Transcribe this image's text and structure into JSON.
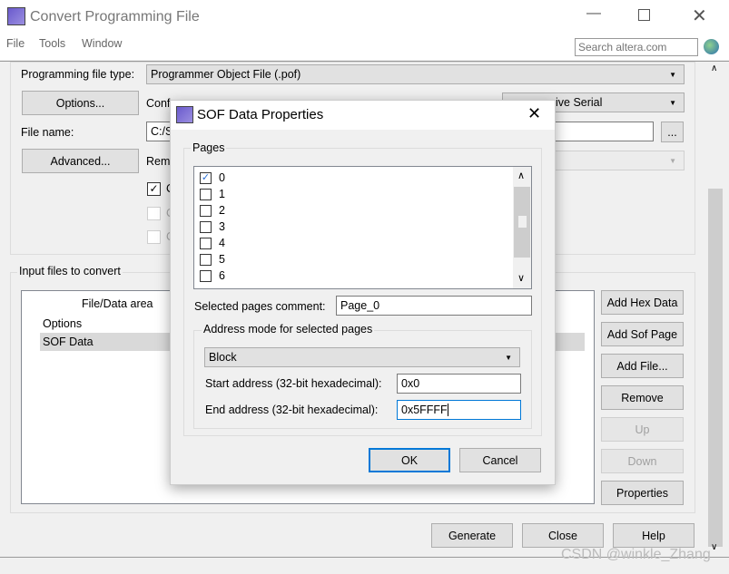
{
  "window": {
    "title": "Convert Programming File",
    "menu": [
      "File",
      "Tools",
      "Window"
    ],
    "search_placeholder": "Search altera.com"
  },
  "form": {
    "programming_file_type_label": "Programming file type:",
    "programming_file_type_value": "Programmer Object File (.pof)",
    "options_button": "Options...",
    "conf_fragment": "Conf",
    "mode_value_fragment": "ive Serial",
    "file_name_label": "File name:",
    "file_name_fragment": "C:/S",
    "browse_button": "...",
    "advanced_button": "Advanced...",
    "rem_fragment": "Rem",
    "cb_fragment": "C",
    "checkbox_checked": true
  },
  "input_files": {
    "group_label": "Input files to convert",
    "column_header": "File/Data area",
    "items": [
      "Options",
      "SOF Data"
    ],
    "selected": "SOF Data",
    "buttons": [
      "Add Hex Data",
      "Add Sof Page",
      "Add File...",
      "Remove",
      "Up",
      "Down",
      "Properties"
    ],
    "disabled": [
      "Up",
      "Down"
    ]
  },
  "footer": {
    "generate": "Generate",
    "close": "Close",
    "help": "Help",
    "watermark": "CSDN @winkle_Zhang"
  },
  "dialog": {
    "title": "SOF Data Properties",
    "pages_label": "Pages",
    "pages": [
      {
        "label": "0",
        "checked": true
      },
      {
        "label": "1",
        "checked": false
      },
      {
        "label": "2",
        "checked": false
      },
      {
        "label": "3",
        "checked": false
      },
      {
        "label": "4",
        "checked": false
      },
      {
        "label": "5",
        "checked": false
      },
      {
        "label": "6",
        "checked": false
      }
    ],
    "comment_label": "Selected pages comment:",
    "comment_value": "Page_0",
    "address_group_label": "Address mode for selected pages",
    "address_mode": "Block",
    "start_label": "Start address (32-bit hexadecimal):",
    "start_value": "0x0",
    "end_label": "End address (32-bit hexadecimal):",
    "end_value": "0x5FFFF",
    "ok": "OK",
    "cancel": "Cancel"
  },
  "colors": {
    "accent": "#0078d7",
    "selection": "#d9d9d9"
  }
}
